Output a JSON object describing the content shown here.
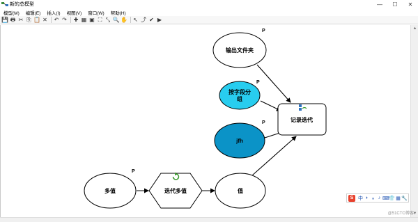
{
  "window": {
    "title": "新的总模型",
    "controls": {
      "minimize": "—",
      "maximize": "☐",
      "close": "✕"
    }
  },
  "menu": [
    {
      "label": "模型(M)"
    },
    {
      "label": "编辑(E)"
    },
    {
      "label": "插入(I)"
    },
    {
      "label": "视图(V)"
    },
    {
      "label": "窗口(W)"
    },
    {
      "label": "帮助(H)"
    }
  ],
  "toolbar": {
    "icons": [
      "save-icon",
      "print-icon",
      "cut-icon",
      "copy-icon",
      "paste-icon",
      "delete-icon",
      "undo-icon",
      "redo-icon",
      "add-data-icon",
      "auto-layout-icon",
      "full-extent-icon",
      "fixed-zoom-in-icon",
      "fixed-zoom-out-icon",
      "zoom-icon",
      "pan-icon",
      "select-icon",
      "connect-icon",
      "validate-icon",
      "run-icon"
    ],
    "glyphs": [
      "💾",
      "🖶",
      "✂",
      "⎘",
      "📋",
      "✕",
      "↶",
      "↷",
      "✚",
      "▦",
      "▣",
      "⛶",
      "⤡",
      "🔍",
      "✋",
      "↖",
      "⤴",
      "✔",
      "▶"
    ]
  },
  "model": {
    "nodes": {
      "output_folder": {
        "label": "输出文件夹",
        "param": "P"
      },
      "group_by_field": {
        "label_line1": "按字段分",
        "label_line2": "组",
        "param": "P"
      },
      "jfh": {
        "label": "jfh",
        "param": "P"
      },
      "record_iteration": {
        "label": "记录迭代"
      },
      "multi_value": {
        "label": "多值",
        "param": "P"
      },
      "iterate_multi_value": {
        "label": "迭代多值"
      },
      "value": {
        "label": "值"
      }
    },
    "colors": {
      "variable_fill": "#ffffff",
      "group_by_field_fill": "#28cdef",
      "jfh_fill": "#0b93c7",
      "tool_fill": "#ffffff",
      "stroke": "#000000",
      "iterator_icon": "#3a9a2e",
      "record_icon": "#2f74c0"
    }
  },
  "ime": {
    "logo": "S",
    "items": [
      "中",
      "◗",
      "⁎",
      "♪",
      "⌨",
      "👕",
      "▦",
      "🔧"
    ]
  },
  "watermark": "@51CTO博客"
}
